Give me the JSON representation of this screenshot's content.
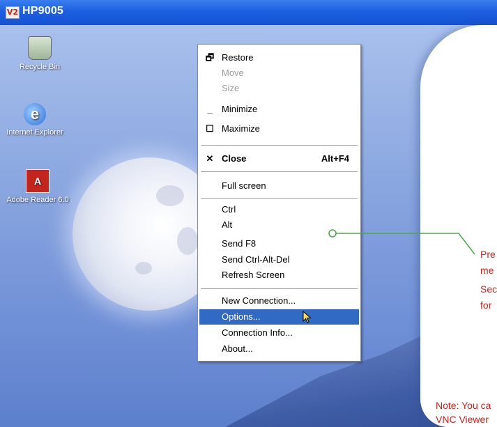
{
  "window": {
    "title": "HP9005",
    "icon_text": "V2"
  },
  "desktop": {
    "icons": [
      {
        "label": "Recycle Bin",
        "icon": "recycle-bin-icon"
      },
      {
        "label": "Internet Explorer",
        "icon": "internet-explorer-icon"
      },
      {
        "label": "Adobe Reader 6.0",
        "icon": "adobe-reader-icon"
      }
    ]
  },
  "menu": {
    "items": [
      {
        "label": "Restore",
        "icon": "restore-icon",
        "glyph": "🗗"
      },
      {
        "label": "Move"
      },
      {
        "label": "Size"
      },
      {
        "label": "Minimize",
        "icon": "minimize-icon",
        "glyph": "_"
      },
      {
        "label": "Maximize",
        "icon": "maximize-icon",
        "glyph": "☐"
      },
      {
        "label": "Close",
        "accelerator": "Alt+F4",
        "icon": "close-icon",
        "glyph": "✕"
      },
      {
        "label": "Full screen"
      },
      {
        "label": "Ctrl"
      },
      {
        "label": "Alt"
      },
      {
        "label": "Send F8"
      },
      {
        "label": "Send Ctrl-Alt-Del"
      },
      {
        "label": "Refresh Screen"
      },
      {
        "label": "New Connection..."
      },
      {
        "label": "Options..."
      },
      {
        "label": "Connection Info..."
      },
      {
        "label": "About..."
      }
    ]
  },
  "callout": {
    "lines": [
      "Pre",
      "me",
      "Sec",
      "for"
    ],
    "note_lines": [
      "Note: You ca",
      "VNC Viewer"
    ]
  },
  "colors": {
    "titlebar": "#1d5fe0",
    "highlight": "#316ac5",
    "callout_line": "#4fa64a",
    "callout_text": "#c3241c"
  }
}
